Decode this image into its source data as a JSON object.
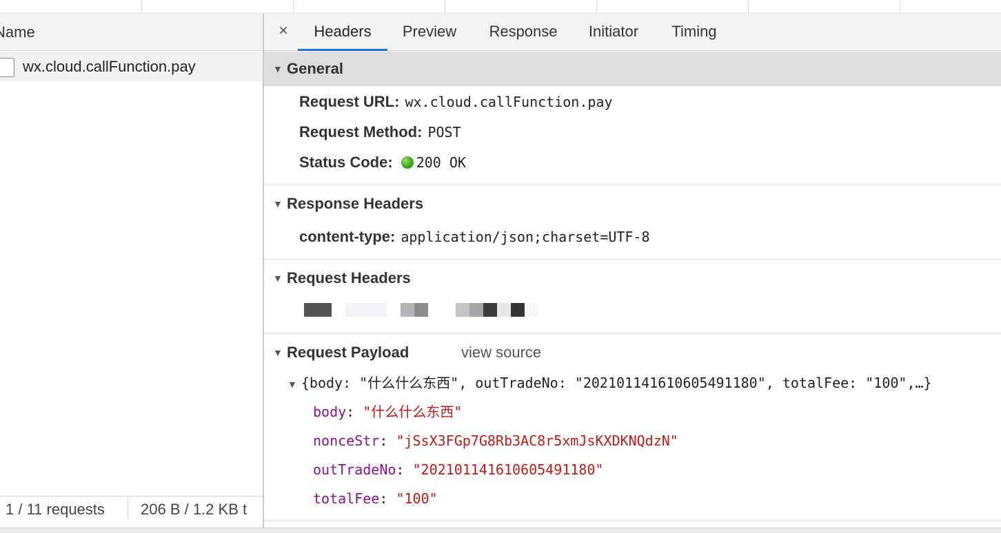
{
  "left": {
    "column_header": "Name",
    "request_name": "wx.cloud.callFunction.pay",
    "status_requests": "1 / 11 requests",
    "status_transferred": "206 B / 1.2 KB t"
  },
  "tabs": {
    "close": "×",
    "items": [
      "Headers",
      "Preview",
      "Response",
      "Initiator",
      "Timing"
    ],
    "active": "Headers"
  },
  "general": {
    "title": "General",
    "request_url_label": "Request URL:",
    "request_url": "wx.cloud.callFunction.pay",
    "request_method_label": "Request Method:",
    "request_method": "POST",
    "status_code_label": "Status Code:",
    "status_code": "200 OK"
  },
  "response_headers": {
    "title": "Response Headers",
    "content_type_label": "content-type:",
    "content_type": "application/json;charset=UTF-8"
  },
  "request_headers": {
    "title": "Request Headers"
  },
  "payload": {
    "title": "Request Payload",
    "view_source": "view source",
    "summary": "{body: \"什么什么东西\", outTradeNo: \"202101141610605491180\", totalFee: \"100\",…}",
    "fields": [
      {
        "key": "body",
        "value": "\"什么什么东西\""
      },
      {
        "key": "nonceStr",
        "value": "\"jSsX3FGp7G8Rb3AC8r5xmJsKXDKNQdzN\""
      },
      {
        "key": "outTradeNo",
        "value": "\"202101141610605491180\""
      },
      {
        "key": "totalFee",
        "value": "\"100\""
      }
    ]
  },
  "colors": {
    "accent": "#1a73e8",
    "key": "#881391",
    "string": "#c41a16",
    "status_ok": "#3aa818"
  }
}
